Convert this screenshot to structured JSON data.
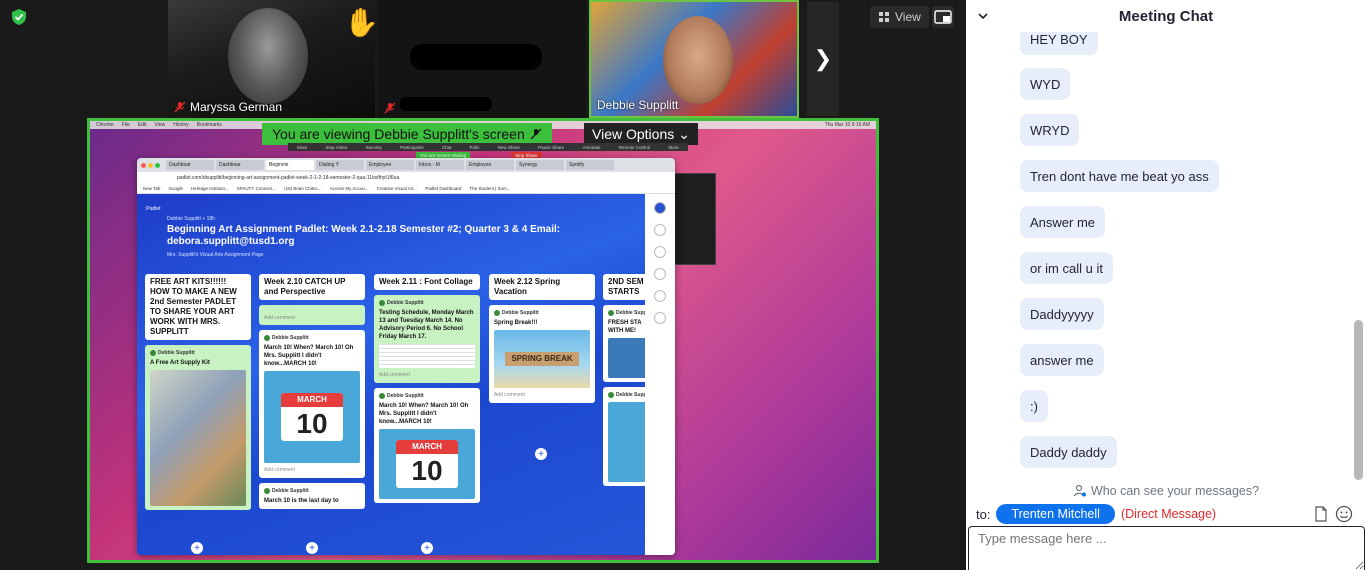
{
  "tiles": [
    {
      "name": "Maryssa German"
    },
    {
      "name": ""
    },
    {
      "name": "Debbie Supplitt"
    }
  ],
  "toolbar": {
    "view_label": "View"
  },
  "share": {
    "banner": "You are viewing Debbie Supplitt's screen",
    "view_options": "View Options",
    "menu_items": [
      "Chrome",
      "File",
      "Edit",
      "View",
      "History",
      "Bookmarks"
    ],
    "clock": "Thu Mar 10  9:16 AM",
    "sub_toolbar": [
      "Mute",
      "Stop Video",
      "Security",
      "Participants",
      "Chat",
      "Polls",
      "New Share",
      "Pause Share",
      "Annotate",
      "Remote Control",
      "More"
    ],
    "sharing_pill": "You are screen sharing",
    "stop_pill": "Stop Share"
  },
  "browser": {
    "tabs": [
      "Dashboar",
      "Dashboar",
      "Beginnin",
      "Dialing Y",
      "Employee",
      "Inbox - M",
      "Employee",
      "Synergy",
      "Spotify"
    ],
    "url": "padlet.com/dsupplitt/beginning-art-assignment-padlet-week-2-1-2-18-semester-2-qua-11bsfthyt1f6ua",
    "bookmarks": [
      "New Tab",
      "Google",
      "Heritage Instituto...",
      "SPAUTY Connect...",
      "(18) Brian Chitec...",
      "Access My Accou...",
      "Creative Visual Art...",
      "Padlet Dashboard",
      "The Student | Sum..."
    ]
  },
  "padlet": {
    "logo": ":Padlet",
    "author": "Debbie Supplitt + 18h",
    "title": "Beginning Art Assignment Padlet: Week 2.1-2.18 Semester #2; Quarter 3 & 4 Email: debora.supplitt@tusd1.org",
    "subtitle": "Mrs. Supplitt's Visual Arts Assignment Page",
    "col1": {
      "head": "FREE ART KITS!!!!!! HOW TO MAKE A NEW 2nd Semester PADLET TO SHARE YOUR ART WORK WITH MRS. SUPPLITT",
      "card_author": "Debbie Supplitt",
      "card_body": "A Free Art Supply Kit"
    },
    "col2": {
      "head": "Week 2.10 CATCH UP and Perspective",
      "add_comment": "Add comment",
      "card_author": "Debbie Supplitt",
      "card_body": "March 10! When? March 10! Oh Mrs. Supplitt I didn't know...MARCH 10!",
      "cal_month": "MARCH",
      "cal_day": "10",
      "card2_author": "Debbie Supplitt",
      "card2_body": "March 10 is the last day to"
    },
    "col3": {
      "head": "Week 2.11 : Font Collage",
      "card_author": "Debbie Supplitt",
      "card_body": "Testing Schedule, Monday March 13 and Tuesday March 14. No Advisory Period 6. No School Friday March 17.",
      "add_comment": "Add comment",
      "card2_author": "Debbie Supplitt",
      "card2_body": "March 10! When? March 10! Oh Mrs. Supplitt I didn't know...MARCH 10!",
      "cal_month": "MARCH",
      "cal_day": "10"
    },
    "col4": {
      "head": "Week 2.12 Spring Vacation",
      "card_author": "Debbie Supplitt",
      "card_body": "Spring Break!!!",
      "sign": "SPRING BREAK",
      "add_comment": "Add comment"
    },
    "col5": {
      "head": "2ND SEM STARTS",
      "card_author": "Debbie Supplitt",
      "card_body": "FRESH STA WITH ME!",
      "card2_author": "Debbie Supplitt"
    }
  },
  "chat": {
    "title": "Meeting Chat",
    "messages": [
      "HEY BOY",
      "WYD",
      "WRYD",
      "Tren dont have me beat yo ass",
      "Answer me",
      "or im call u it",
      "Daddyyyyy",
      "answer me",
      ":)",
      "Daddy daddy"
    ],
    "who_can_see": "Who can see your messages?",
    "to_label": "to:",
    "recipient": "Trenten Mitchell",
    "direct": "(Direct Message)",
    "placeholder": "Type message here ..."
  },
  "colors": {
    "accent": "#0e72ed",
    "share_border": "#3fbf3a",
    "direct": "#e02828"
  }
}
